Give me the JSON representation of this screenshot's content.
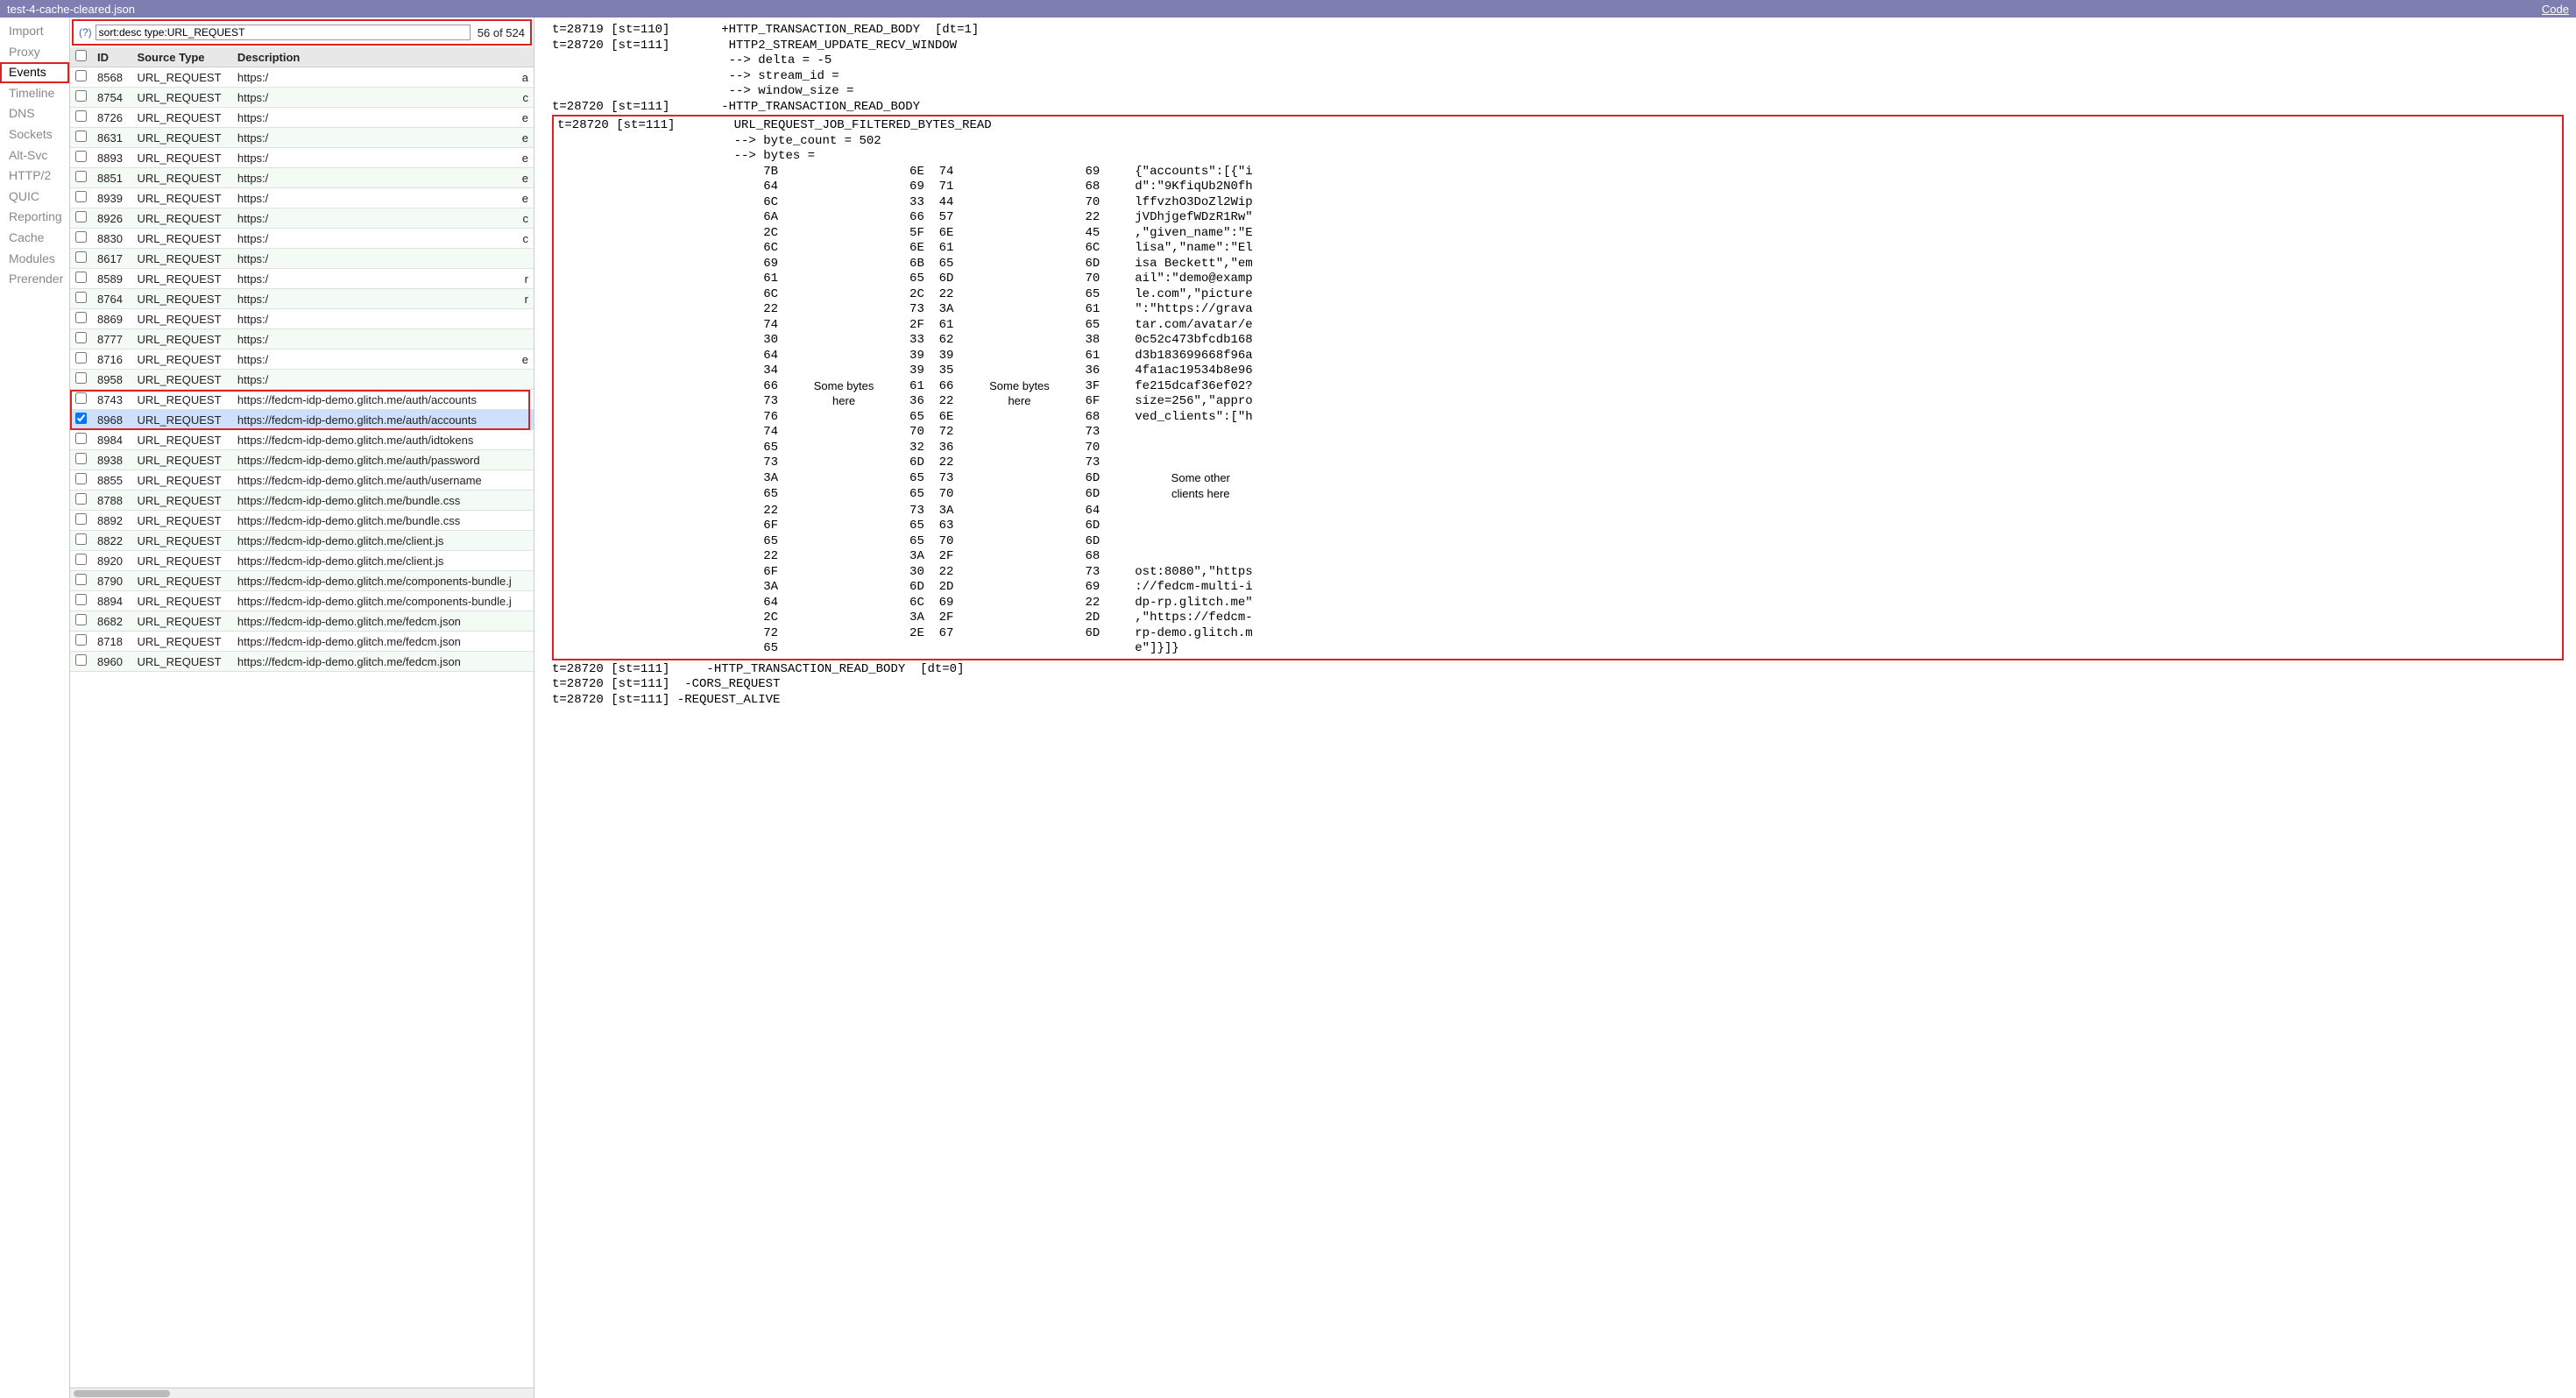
{
  "titlebar": {
    "filename": "test-4-cache-cleared.json",
    "code_link": "Code"
  },
  "sidebar": {
    "items": [
      {
        "label": "Import"
      },
      {
        "label": "Proxy"
      },
      {
        "label": "Events",
        "active": true,
        "highlighted": true
      },
      {
        "label": "Timeline"
      },
      {
        "label": "DNS"
      },
      {
        "label": "Sockets"
      },
      {
        "label": "Alt-Svc"
      },
      {
        "label": "HTTP/2"
      },
      {
        "label": "QUIC"
      },
      {
        "label": "Reporting"
      },
      {
        "label": "Cache"
      },
      {
        "label": "Modules"
      },
      {
        "label": "Prerender"
      }
    ]
  },
  "filter": {
    "help": "(?)",
    "value": "sort:desc type:URL_REQUEST",
    "count": "56 of 524"
  },
  "columns": {
    "id": "ID",
    "source": "Source Type",
    "desc": "Description"
  },
  "rows": [
    {
      "id": "8568",
      "src": "URL_REQUEST",
      "desc": "https:/",
      "trail": "a"
    },
    {
      "id": "8754",
      "src": "URL_REQUEST",
      "desc": "https:/",
      "trail": "c"
    },
    {
      "id": "8726",
      "src": "URL_REQUEST",
      "desc": "https:/",
      "trail": "e"
    },
    {
      "id": "8631",
      "src": "URL_REQUEST",
      "desc": "https:/",
      "trail": "e"
    },
    {
      "id": "8893",
      "src": "URL_REQUEST",
      "desc": "https:/",
      "trail": "e"
    },
    {
      "id": "8851",
      "src": "URL_REQUEST",
      "desc": "https:/",
      "trail": "e"
    },
    {
      "id": "8939",
      "src": "URL_REQUEST",
      "desc": "https:/",
      "trail": "e"
    },
    {
      "id": "8926",
      "src": "URL_REQUEST",
      "desc": "https:/",
      "trail": "c"
    },
    {
      "id": "8830",
      "src": "URL_REQUEST",
      "desc": "https:/",
      "trail": "c"
    },
    {
      "id": "8617",
      "src": "URL_REQUEST",
      "desc": "https:/",
      "trail": ""
    },
    {
      "id": "8589",
      "src": "URL_REQUEST",
      "desc": "https:/",
      "trail": "r"
    },
    {
      "id": "8764",
      "src": "URL_REQUEST",
      "desc": "https:/",
      "trail": "r"
    },
    {
      "id": "8869",
      "src": "URL_REQUEST",
      "desc": "https:/",
      "trail": ""
    },
    {
      "id": "8777",
      "src": "URL_REQUEST",
      "desc": "https:/",
      "trail": ""
    },
    {
      "id": "8716",
      "src": "URL_REQUEST",
      "desc": "https:/",
      "trail": "e"
    },
    {
      "id": "8958",
      "src": "URL_REQUEST",
      "desc": "https:/",
      "trail": ""
    },
    {
      "id": "8743",
      "src": "URL_REQUEST",
      "desc": "https://fedcm-idp-demo.glitch.me/auth/accounts",
      "trail": "",
      "boxpair": true
    },
    {
      "id": "8968",
      "src": "URL_REQUEST",
      "desc": "https://fedcm-idp-demo.glitch.me/auth/accounts",
      "trail": "",
      "selected": true,
      "boxpair": true
    },
    {
      "id": "8984",
      "src": "URL_REQUEST",
      "desc": "https://fedcm-idp-demo.glitch.me/auth/idtokens",
      "trail": ""
    },
    {
      "id": "8938",
      "src": "URL_REQUEST",
      "desc": "https://fedcm-idp-demo.glitch.me/auth/password",
      "trail": ""
    },
    {
      "id": "8855",
      "src": "URL_REQUEST",
      "desc": "https://fedcm-idp-demo.glitch.me/auth/username",
      "trail": ""
    },
    {
      "id": "8788",
      "src": "URL_REQUEST",
      "desc": "https://fedcm-idp-demo.glitch.me/bundle.css",
      "trail": ""
    },
    {
      "id": "8892",
      "src": "URL_REQUEST",
      "desc": "https://fedcm-idp-demo.glitch.me/bundle.css",
      "trail": ""
    },
    {
      "id": "8822",
      "src": "URL_REQUEST",
      "desc": "https://fedcm-idp-demo.glitch.me/client.js",
      "trail": ""
    },
    {
      "id": "8920",
      "src": "URL_REQUEST",
      "desc": "https://fedcm-idp-demo.glitch.me/client.js",
      "trail": ""
    },
    {
      "id": "8790",
      "src": "URL_REQUEST",
      "desc": "https://fedcm-idp-demo.glitch.me/components-bundle.j",
      "trail": ""
    },
    {
      "id": "8894",
      "src": "URL_REQUEST",
      "desc": "https://fedcm-idp-demo.glitch.me/components-bundle.j",
      "trail": ""
    },
    {
      "id": "8682",
      "src": "URL_REQUEST",
      "desc": "https://fedcm-idp-demo.glitch.me/fedcm.json",
      "trail": ""
    },
    {
      "id": "8718",
      "src": "URL_REQUEST",
      "desc": "https://fedcm-idp-demo.glitch.me/fedcm.json",
      "trail": ""
    },
    {
      "id": "8960",
      "src": "URL_REQUEST",
      "desc": "https://fedcm-idp-demo.glitch.me/fedcm.json",
      "trail": ""
    }
  ],
  "detail": {
    "pre_lines": [
      "t=28719 [st=110]       +HTTP_TRANSACTION_READ_BODY  [dt=1]",
      "t=28720 [st=111]        HTTP2_STREAM_UPDATE_RECV_WINDOW",
      "                        --> delta = -5",
      "                        --> stream_id =",
      "                        --> window_size =",
      "t=28720 [st=111]       -HTTP_TRANSACTION_READ_BODY"
    ],
    "box_header": [
      "t=28720 [st=111]        URL_REQUEST_JOB_FILTERED_BYTES_READ",
      "                        --> byte_count = 502",
      "                        --> bytes ="
    ],
    "hex": {
      "col1": [
        "7B",
        "64",
        "6C",
        "6A",
        "2C",
        "6C",
        "69",
        "61",
        "6C",
        "22",
        "74",
        "30",
        "64",
        "34",
        "66",
        "73",
        "76",
        "74",
        "65",
        "73",
        "3A",
        "65",
        "22",
        "6F",
        "65",
        "22",
        "6F",
        "3A",
        "64",
        "2C",
        "72",
        "65"
      ],
      "note1a": "Some bytes",
      "note1b": "here",
      "col2a": [
        "6E",
        "69",
        "33",
        "66",
        "5F",
        "6E",
        "6B",
        "65",
        "2C",
        "73",
        "2F",
        "33",
        "39",
        "39",
        "61",
        "36",
        "65",
        "70",
        "32",
        "6D",
        "65",
        "65",
        "73",
        "65",
        "65",
        "3A",
        "30",
        "6D",
        "6C",
        "3A",
        "2E",
        ""
      ],
      "col2b": [
        "74",
        "71",
        "44",
        "57",
        "6E",
        "61",
        "65",
        "6D",
        "22",
        "3A",
        "61",
        "62",
        "39",
        "35",
        "66",
        "22",
        "6E",
        "72",
        "36",
        "22",
        "73",
        "70",
        "3A",
        "63",
        "70",
        "2F",
        "22",
        "2D",
        "69",
        "2F",
        "67",
        ""
      ],
      "note2a": "Some bytes",
      "note2b": "here",
      "col3": [
        "69",
        "68",
        "70",
        "22",
        "45",
        "6C",
        "6D",
        "70",
        "65",
        "61",
        "65",
        "38",
        "61",
        "36",
        "3F",
        "6F",
        "68",
        "73",
        "70",
        "73",
        "6D",
        "6D",
        "64",
        "6D",
        "6D",
        "68",
        "73",
        "69",
        "22",
        "2D",
        "6D",
        ""
      ],
      "ascii": [
        "{\"accounts\":[{\"i",
        "d\":\"9KfiqUb2N0fh",
        "lffvzhO3DoZl2Wip",
        "jVDhjgefWDzR1Rw\"",
        ",\"given_name\":\"E",
        "lisa\",\"name\":\"El",
        "isa Beckett\",\"em",
        "ail\":\"demo@examp",
        "le.com\",\"picture",
        "\":\"https://grava",
        "tar.com/avatar/e",
        "0c52c473bfcdb168",
        "d3b183699668f96a",
        "4fa1ac19534b8e96",
        "fe215dcaf36ef02?",
        "size=256\",\"appro",
        "ved_clients\":[\"h",
        "",
        "",
        "",
        "",
        "",
        "",
        "",
        "",
        "",
        "ost:8080\",\"https",
        "://fedcm-multi-i",
        "dp-rp.glitch.me\"",
        ",\"https://fedcm-",
        "rp-demo.glitch.m",
        "e\"]}]}"
      ],
      "note3a": "Some other",
      "note3b": "clients here"
    },
    "post_lines": [
      "t=28720 [st=111]     -HTTP_TRANSACTION_READ_BODY  [dt=0]",
      "t=28720 [st=111]  -CORS_REQUEST",
      "t=28720 [st=111] -REQUEST_ALIVE"
    ]
  }
}
